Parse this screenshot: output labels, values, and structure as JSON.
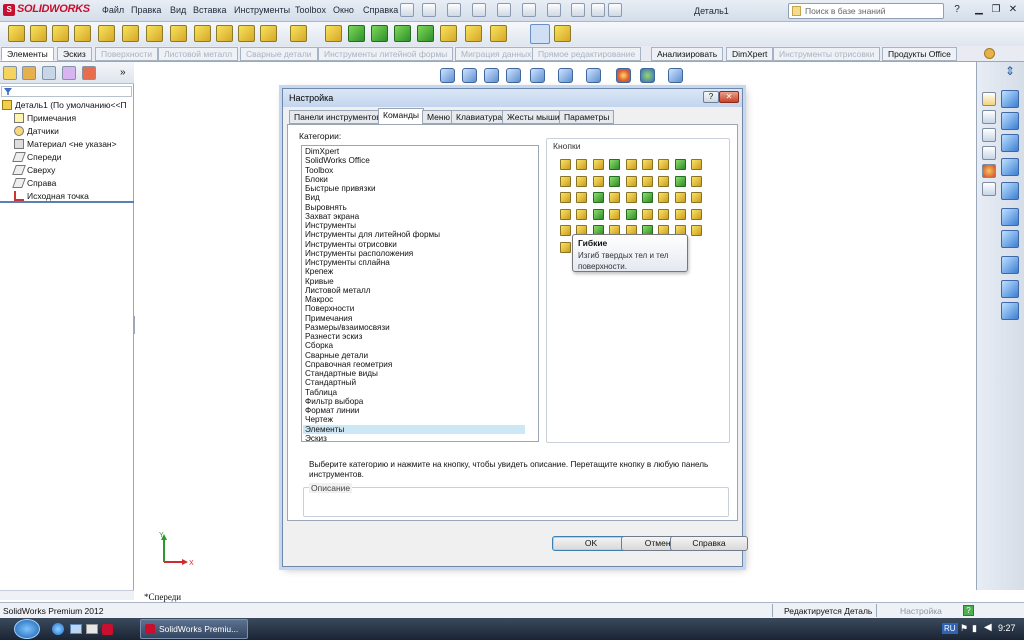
{
  "app": {
    "logo_text": "SOLIDWORKS",
    "menu": [
      "Файл",
      "Правка",
      "Вид",
      "Вставка",
      "Инструменты",
      "Toolbox",
      "Окно",
      "Справка"
    ],
    "doc_title": "Деталь1",
    "search_placeholder": "Поиск в базе знаний",
    "help_label": "?"
  },
  "command_tabs": [
    {
      "label": "Элементы",
      "state": "active"
    },
    {
      "label": "Эскиз",
      "state": "normal"
    },
    {
      "label": "Поверхности",
      "state": "disabled"
    },
    {
      "label": "Листовой металл",
      "state": "disabled"
    },
    {
      "label": "Сварные детали",
      "state": "disabled"
    },
    {
      "label": "Инструменты литейной формы",
      "state": "disabled"
    },
    {
      "label": "Миграция данных",
      "state": "disabled"
    },
    {
      "label": "Прямое редактирование",
      "state": "disabled"
    },
    {
      "label": "Анализировать",
      "state": "normal"
    },
    {
      "label": "DimXpert",
      "state": "normal"
    },
    {
      "label": "Инструменты отрисовки",
      "state": "disabled"
    },
    {
      "label": "Продукты Office",
      "state": "normal"
    }
  ],
  "feature_tree": {
    "root": "Деталь1  (По умолчанию<<П",
    "items": [
      "Примечания",
      "Датчики",
      "Материал <не указан>",
      "Спереди",
      "Сверху",
      "Справа",
      "Исходная точка"
    ]
  },
  "graphics": {
    "view_label": "*Спереди",
    "axis_y": "Y",
    "axis_x": "X"
  },
  "status": {
    "product": "SolidWorks Premium 2012",
    "editing": "Редактируется Деталь",
    "settings": "Настройка"
  },
  "taskbar": {
    "task": "SolidWorks Premiu...",
    "lang": "RU",
    "clock": "9:27"
  },
  "dialog": {
    "title": "Настройка",
    "tabs": [
      {
        "label": "Панели инструментов",
        "active": false
      },
      {
        "label": "Команды",
        "active": true
      },
      {
        "label": "Меню",
        "active": false
      },
      {
        "label": "Клавиатура",
        "active": false
      },
      {
        "label": "Жесты мыши",
        "active": false
      },
      {
        "label": "Параметры",
        "active": false
      }
    ],
    "categories_label": "Категории:",
    "categories": [
      "DimXpert",
      "SolidWorks Office",
      "Toolbox",
      "Блоки",
      "Быстрые привязки",
      "Вид",
      "Выровнять",
      "Захват экрана",
      "Инструменты",
      "Инструменты для литейной формы",
      "Инструменты отрисовки",
      "Инструменты расположения",
      "Инструменты сплайна",
      "Крепеж",
      "Кривые",
      "Листовой металл",
      "Макрос",
      "Поверхности",
      "Примечания",
      "Размеры/взаимосвязи",
      "Разнести эскиз",
      "Сборка",
      "Сварные детали",
      "Справочная геометрия",
      "Стандартные виды",
      "Стандартный",
      "Таблица",
      "Фильтр выбора",
      "Формат линии",
      "Чертеж",
      "Элементы",
      "Эскиз"
    ],
    "selected_category": "Элементы",
    "buttons_label": "Кнопки",
    "tooltip_title": "Гибкие",
    "tooltip_desc": "Изгиб твердых тел и тел поверхности.",
    "hint": "Выберите категорию и нажмите на кнопку, чтобы увидеть описание. Перетащите кнопку в любую панель инструментов.",
    "description_label": "Описание",
    "ok": "OK",
    "cancel": "Отмена",
    "help": "Справка"
  },
  "colors": {
    "accent": "#3c7fb1",
    "brand": "#c8102e",
    "selection": "#cde8f5"
  }
}
